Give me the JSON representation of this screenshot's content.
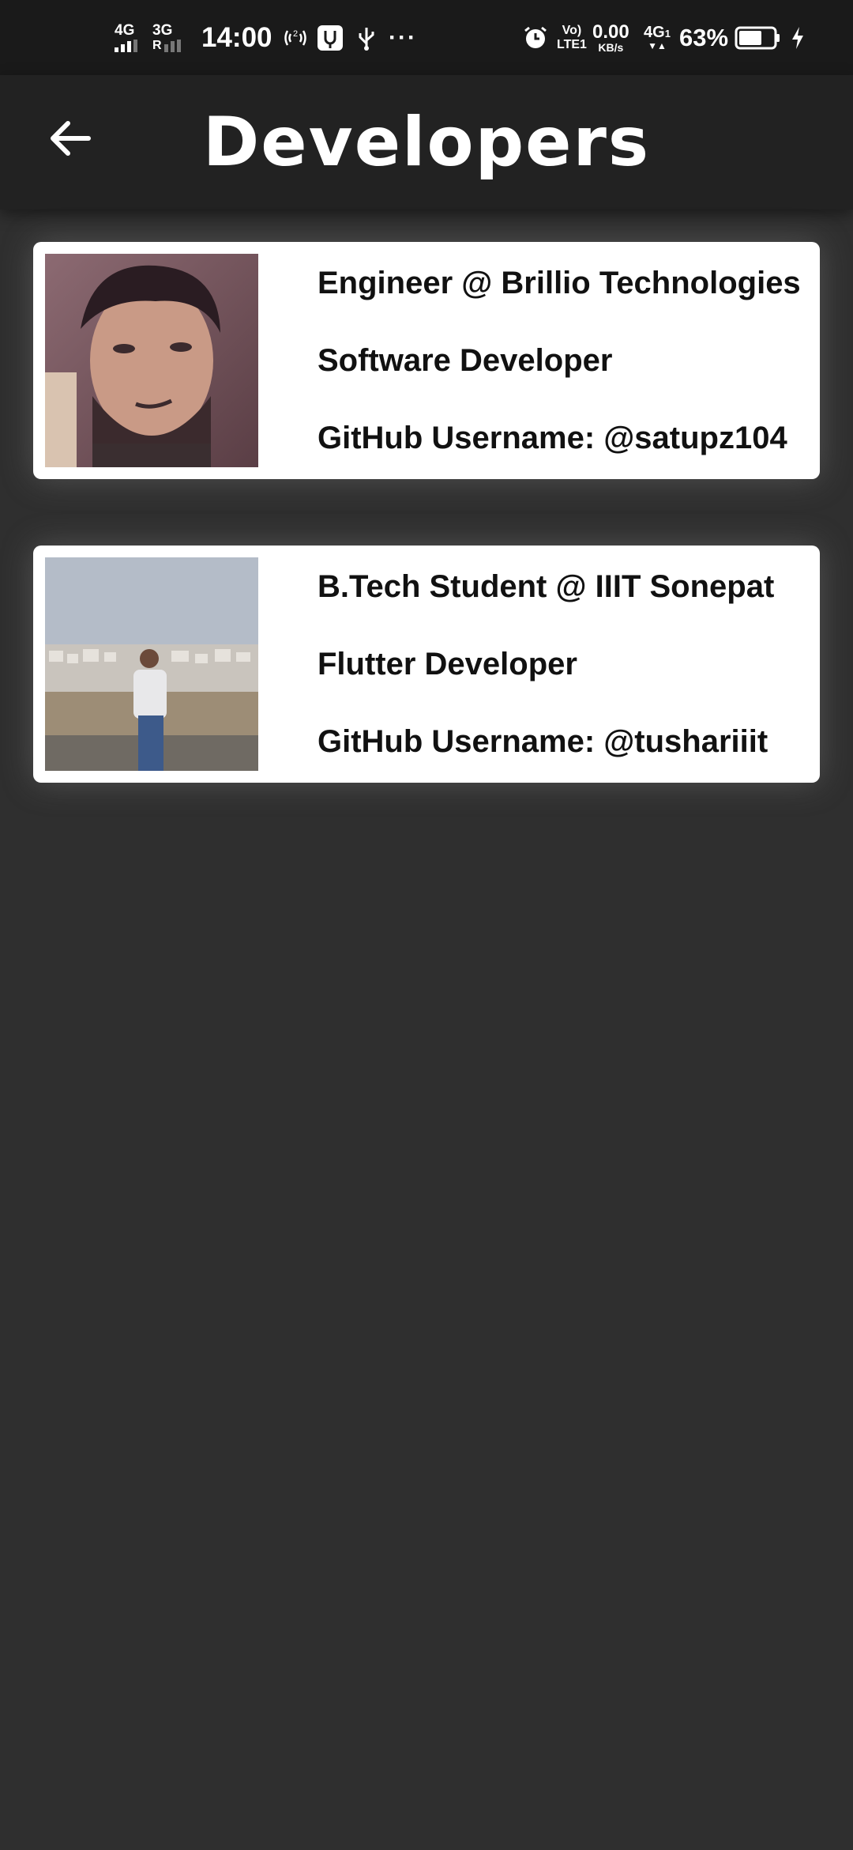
{
  "status_bar": {
    "net1": "4G",
    "net2": "3G",
    "net2_sub": "R",
    "time": "14:00",
    "hotspot_badge": "2",
    "more": "···",
    "volte": "Vo)",
    "lte_label": "LTE1",
    "speed_value": "0.00",
    "speed_unit": "KB/s",
    "net3": "4G",
    "net3_sub": "1",
    "battery": "63%",
    "icons": [
      "signal-icon",
      "hotspot-icon",
      "usb-debug-icon",
      "usb-icon",
      "alarm-icon",
      "battery-icon",
      "charging-icon"
    ]
  },
  "appbar": {
    "title": "Developers",
    "back_icon": "arrow-back-icon"
  },
  "developers": [
    {
      "role": "Engineer @ Brillio Technologies",
      "title": "Software Developer",
      "github": "GitHub Username: @satupz104"
    },
    {
      "role": "B.Tech Student @ IIIT Sonepat",
      "title": "Flutter Developer",
      "github": "GitHub Username: @tushariiit"
    }
  ],
  "colors": {
    "background": "#2f2f2f",
    "appbar": "#222222",
    "statusbar": "#1a1a1a",
    "card": "#ffffff",
    "text": "#111111"
  }
}
